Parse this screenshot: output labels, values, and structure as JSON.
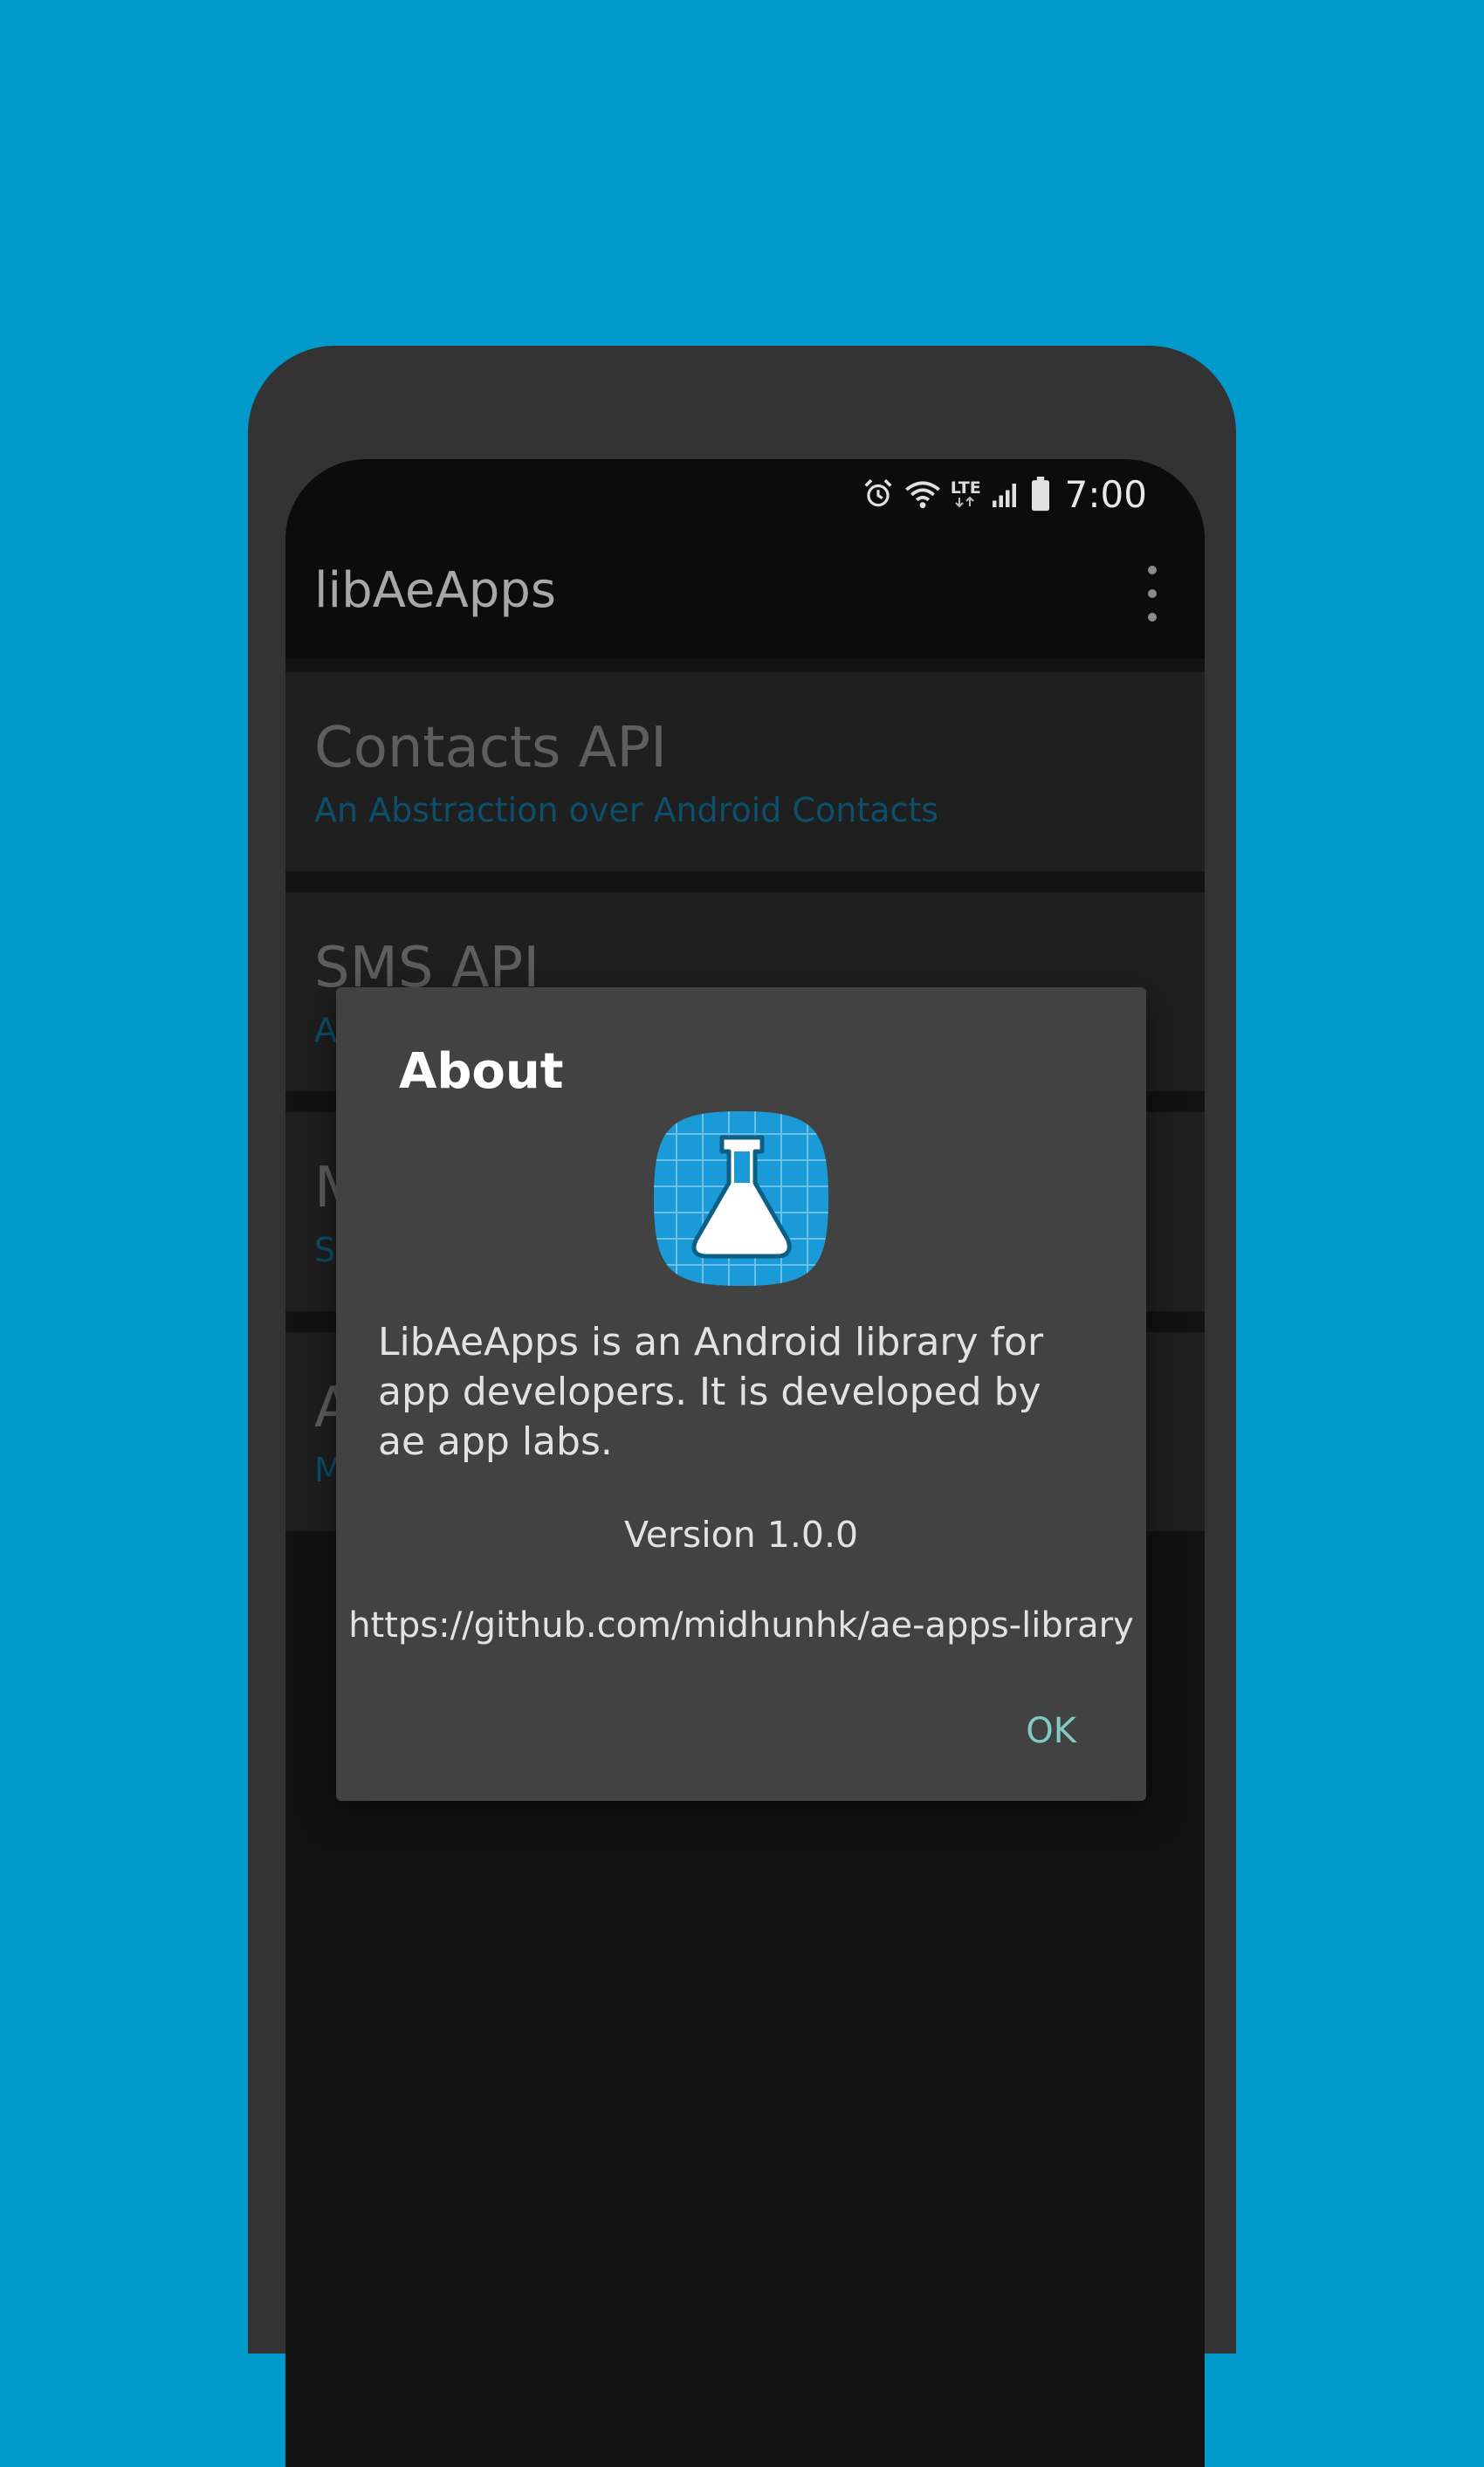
{
  "status_bar": {
    "time": "7:00",
    "network_label": "LTE",
    "icons": [
      "alarm-icon",
      "wifi-icon",
      "lte-icon",
      "signal-icon",
      "battery-icon"
    ]
  },
  "app_bar": {
    "title": "libAeApps",
    "menu_icon": "overflow-menu-icon"
  },
  "cards": [
    {
      "title": "Contacts API",
      "subtitle": "An Abstraction over Android Contacts"
    },
    {
      "title": "SMS API",
      "subtitle": "A"
    },
    {
      "title": "M",
      "subtitle": "S"
    },
    {
      "title": "A",
      "subtitle": "M"
    }
  ],
  "dialog": {
    "title": "About",
    "logo_icon": "flask-icon",
    "description": "LibAeApps is an Android library for app developers. It is developed by ae app labs.",
    "version": "Version 1.0.0",
    "url": "https://github.com/midhunhk/ae-apps-library",
    "ok_label": "OK"
  },
  "colors": {
    "background": "#0099cc",
    "accent": "#80cbc4",
    "dialog_bg": "#424242",
    "subtitle": "#0b4f6a"
  }
}
